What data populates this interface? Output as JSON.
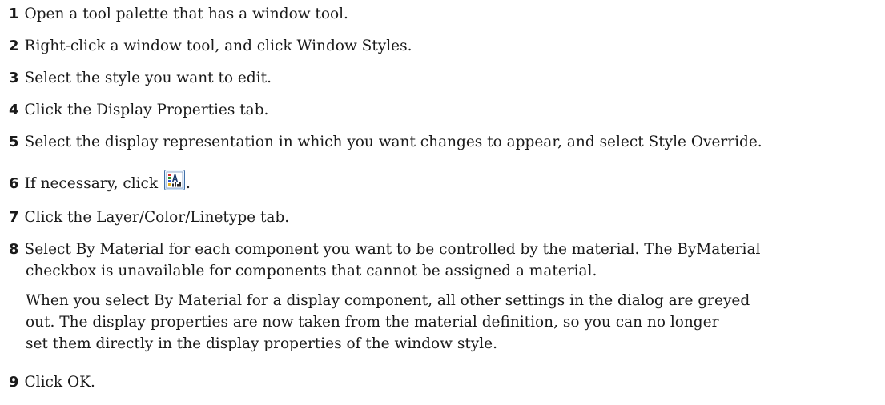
{
  "steps": [
    {
      "num": "1",
      "text": "Open a tool palette that has a window tool."
    },
    {
      "num": "2",
      "text": "Right-click a window tool, and click Window Styles."
    },
    {
      "num": "3",
      "text": "Select the style you want to edit."
    },
    {
      "num": "4",
      "text": "Click the Display Properties tab."
    },
    {
      "num": "5",
      "text": "Select the display representation in which you want changes to appear, and select Style Override."
    },
    {
      "num": "6",
      "text": "If necessary, click",
      "text_after": ".",
      "icon": "edit-display-properties-icon"
    },
    {
      "num": "7",
      "text": "Click the Layer/Color/Linetype tab."
    },
    {
      "num": "8",
      "text": "Select By Material for each component you want to be controlled by the material. The ByMaterial",
      "text_cont": "checkbox is unavailable for components that cannot be assigned a material."
    },
    {
      "num": "9",
      "text": "Click OK."
    }
  ],
  "note": {
    "lines": [
      "When you select By Material for a display component, all other settings in the dialog are greyed",
      "out. The display properties are now taken from the material definition, so you can no longer",
      "set them directly in the display properties of the window style."
    ]
  }
}
